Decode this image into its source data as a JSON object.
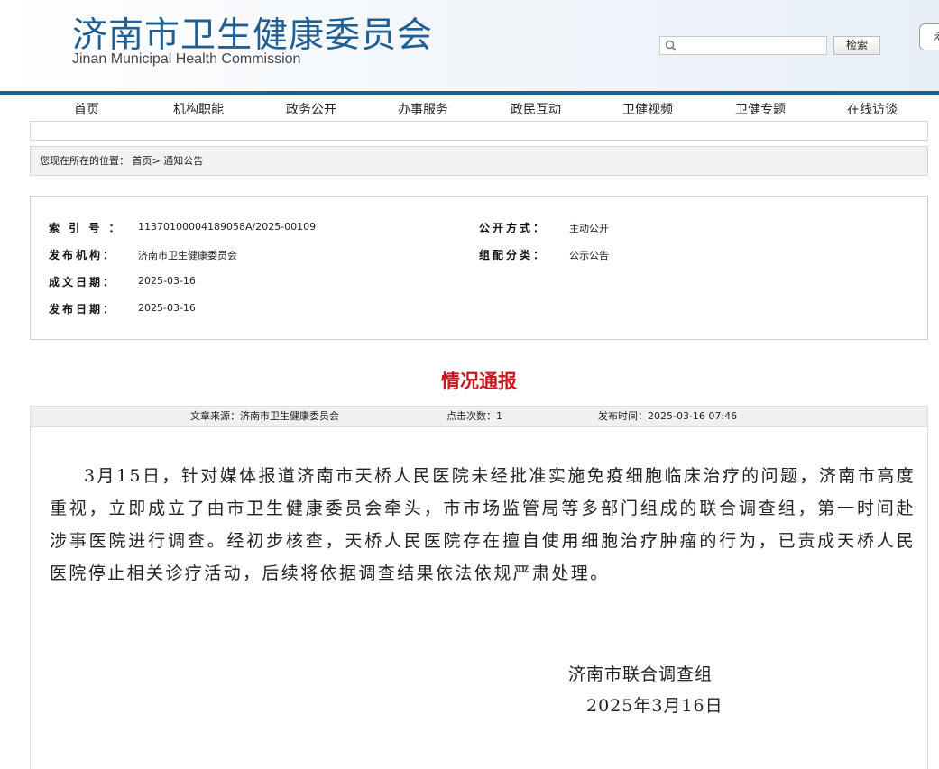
{
  "header": {
    "title_cn": "济南市卫生健康委员会",
    "title_en": "Jinan Municipal Health Commission",
    "search_placeholder": "",
    "search_button": "检索",
    "corner_button": "え"
  },
  "nav": {
    "items": [
      "首页",
      "机构职能",
      "政务公开",
      "办事服务",
      "政民互动",
      "卫健视频",
      "卫健专题",
      "在线访谈"
    ]
  },
  "breadcrumb": {
    "text": "您现在所在的位置：  首页> 通知公告"
  },
  "meta": {
    "index_label": "索 引 号 ：",
    "index_value": "11370100004189058A/2025-00109",
    "publisher_label": "发布机构：",
    "publisher_value": "济南市卫生健康委员会",
    "written_label": "成文日期：",
    "written_value": "2025-03-16",
    "published_label": "发布日期：",
    "published_value": "2025-03-16",
    "disclosure_label": "公开方式：",
    "disclosure_value": "主动公开",
    "category_label": "组配分类：",
    "category_value": "公示公告"
  },
  "article": {
    "title": "情况通报",
    "source": "文章来源：济南市卫生健康委员会",
    "clicks": "点击次数：1",
    "publish_time": "发布时间：2025-03-16 07:46",
    "body": "3月15日，针对媒体报道济南市天桥人民医院未经批准实施免疫细胞临床治疗的问题，济南市高度重视，立即成立了由市卫生健康委员会牵头，市市场监管局等多部门组成的联合调查组，第一时间赴涉事医院进行调查。经初步核查，天桥人民医院存在擅自使用细胞治疗肿瘤的行为，已责成天桥人民医院停止相关诊疗活动，后续将依据调查结果依法依规严肃处理。",
    "signature_org": "济南市联合调查组",
    "signature_date": "2025年3月16日"
  },
  "colors": {
    "brand_blue": "#1f5f93",
    "header_rule": "#1f5e8e",
    "title_red": "#c8161d"
  }
}
